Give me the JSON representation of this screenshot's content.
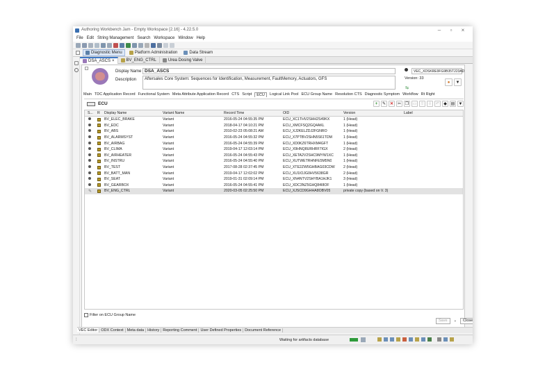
{
  "window": {
    "title": "Authoring Workbench Jam - Empty Workspace [2.16] - 4.22.5.0"
  },
  "menu": [
    "File",
    "Edit",
    "String Management",
    "Search",
    "Workspace",
    "Window",
    "Help"
  ],
  "perspectives": [
    {
      "label": "Diagnostic Menu",
      "active": true
    },
    {
      "label": "Platform Administration",
      "active": false
    },
    {
      "label": "Data Stream",
      "active": false
    }
  ],
  "editor_tabs": [
    {
      "label": "DSA_ASCS",
      "active": true
    },
    {
      "label": "BV_ENG_CTRL",
      "active": false
    },
    {
      "label": "Urea Dosing Valve",
      "active": false
    }
  ],
  "header": {
    "display_name_label": "Display Name",
    "display_name": "DSA_ASCS",
    "description_label": "Description",
    "description": "Aftersales Core System: Sequences for Identification, Measurement, FaultMemory, Actuators, GFS",
    "id_value": "VEC_XDSKRE9FG9B35T223AD",
    "version_label": "Version: 33"
  },
  "sub_tabs": [
    {
      "label": "Main",
      "active": false
    },
    {
      "label": "TDC Application Record",
      "active": false
    },
    {
      "label": "Functional System",
      "active": false
    },
    {
      "label": "Meta Attribute Application Record",
      "active": false
    },
    {
      "label": "CTS",
      "active": false
    },
    {
      "label": "Script",
      "active": false
    },
    {
      "label": "ECU",
      "active": true
    },
    {
      "label": "Logical Link Pool",
      "active": false
    },
    {
      "label": "ECU Group Name",
      "active": false
    },
    {
      "label": "Resolution CTS",
      "active": false
    },
    {
      "label": "Diagnostic Symptom",
      "active": false
    },
    {
      "label": "Workflow",
      "active": false
    },
    {
      "label": "Rt Right",
      "active": false
    }
  ],
  "section_title": "ECU",
  "table": {
    "columns": [
      "S...",
      "R",
      "Display Name",
      "Variant Name",
      "Record Time",
      "OID",
      "Version",
      "Label"
    ],
    "rows": [
      {
        "name": "BV_ELEC_BRAKE",
        "variant": "Variant",
        "time": "2016-05-24 04:55:35 PM",
        "oid": "ECU_XC1THV2SHH2S49KX",
        "version": "1 (Head)",
        "label": "",
        "status": "dot"
      },
      {
        "name": "BV_EDC",
        "variant": "Variant",
        "time": "2018-04-17 04:10:21 PM",
        "oid": "ECU_XMCFSQ2GQ4AKL",
        "version": "1 (Head)",
        "label": "",
        "status": "dot"
      },
      {
        "name": "BV_ABS",
        "variant": "Variant",
        "time": "2010-02-23 05:08:21 AM",
        "oid": "ECU_XJ2KELZDJ2FGNRO",
        "version": "1 (Head)",
        "label": "",
        "status": "dot"
      },
      {
        "name": "BV_ALARMSYST",
        "variant": "Variant",
        "time": "2016-05-24 04:55:32 PM",
        "oid": "ECU_X7PTBV2SHN5S61TDM",
        "version": "1 (Head)",
        "label": "",
        "status": "dot"
      },
      {
        "name": "BV_AIRBAG",
        "variant": "Variant",
        "time": "2016-05-24 04:55:39 PM",
        "oid": "ECU_XD0KZ6TRHXM4GFT",
        "version": "1 (Head)",
        "label": "",
        "status": "dot"
      },
      {
        "name": "BV_CLIMA",
        "variant": "Variant",
        "time": "2019-04-17 12:03:14 PM",
        "oid": "ECU_X9HNQ8URHRF7IGX",
        "version": "2 (Head)",
        "label": "",
        "status": "dot"
      },
      {
        "name": "BV_AIRHEATER",
        "variant": "Variant",
        "time": "2016-05-24 04:55:43 PM",
        "oid": "ECU_XETA2V2SHC9MYW1XC",
        "version": "1 (Head)",
        "label": "",
        "status": "dot"
      },
      {
        "name": "BV_INSTRU",
        "variant": "Variant",
        "time": "2016-05-24 04:55:40 PM",
        "oid": "ECU_XUTWETRHNFE5M5N0",
        "version": "1 (Head)",
        "label": "",
        "status": "dot"
      },
      {
        "name": "BV_TEST",
        "variant": "Variant",
        "time": "2017-08-28 02:37:45 PM",
        "oid": "ECU_XTE2ZW5GHBAG03CDW",
        "version": "2 (Head)",
        "label": "",
        "status": "dot"
      },
      {
        "name": "BV_BATT_MAN",
        "variant": "Variant",
        "time": "2019-04-17 12:02:02 PM",
        "oid": "ECU_XU1IOJG0HV5638GR",
        "version": "2 (Head)",
        "label": "",
        "status": "dot"
      },
      {
        "name": "BV_SEAT",
        "variant": "Variant",
        "time": "2019-01-31 02:09:14 PM",
        "oid": "ECU_XN4NTV2SHYBA1HJK1",
        "version": "3 (Head)",
        "label": "",
        "status": "dot"
      },
      {
        "name": "BV_GEARBOX",
        "variant": "Variant",
        "time": "2016-05-24 04:55:41 PM",
        "oid": "ECU_XDC3NZ5GHQ84I8OF",
        "version": "1 (Head)",
        "label": "",
        "status": "dot"
      },
      {
        "name": "BV_ENG_CTRL",
        "variant": "Variant",
        "time": "2020-03-05 02:25:50 PM",
        "oid": "ECU_XJSCD9GHHA8OBV05",
        "version": "private copy (based on V. 3)",
        "label": "",
        "status": "pencil",
        "selected": true
      }
    ]
  },
  "filter_label": "Filter on ECU Group Name",
  "buttons": {
    "save": "Save",
    "close": "Close"
  },
  "bottom_tabs": [
    {
      "label": "VEC Editor",
      "active": true
    },
    {
      "label": "ODX Context",
      "active": false
    },
    {
      "label": "Meta data",
      "active": false
    },
    {
      "label": "History",
      "active": false
    },
    {
      "label": "Reporting Comment",
      "active": false
    },
    {
      "label": "User Defined Properties",
      "active": false
    },
    {
      "label": "Document Reference",
      "active": false
    }
  ],
  "status": {
    "message": "Waiting for artifacts database"
  },
  "colors": {
    "accent": "#3d77c6",
    "add": "#4caf50",
    "delete": "#d32f2f"
  }
}
